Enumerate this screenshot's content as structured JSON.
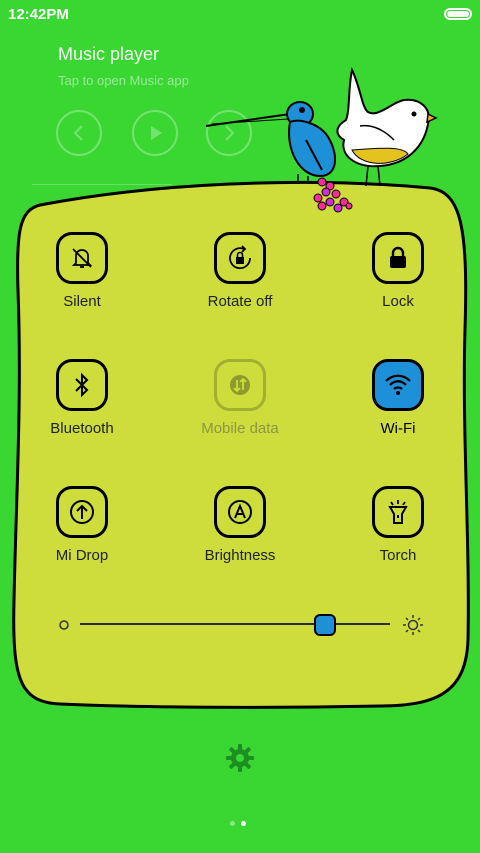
{
  "status_bar": {
    "time": "12:42PM",
    "battery_icon": "battery-full-icon"
  },
  "music_player": {
    "title": "Music player",
    "subtitle": "Tap to open Music app",
    "controls": [
      "previous-icon",
      "play-icon",
      "next-icon"
    ]
  },
  "toggles": [
    {
      "label": "Silent",
      "icon": "bell-off-icon",
      "state": "off"
    },
    {
      "label": "Rotate off",
      "icon": "rotate-lock-icon",
      "state": "off"
    },
    {
      "label": "Lock",
      "icon": "padlock-icon",
      "state": "off"
    },
    {
      "label": "Bluetooth",
      "icon": "bluetooth-icon",
      "state": "off"
    },
    {
      "label": "Mobile data",
      "icon": "mobile-data-icon",
      "state": "disabled"
    },
    {
      "label": "Wi-Fi",
      "icon": "wifi-icon",
      "state": "on"
    },
    {
      "label": "Mi Drop",
      "icon": "upload-arrow-icon",
      "state": "off"
    },
    {
      "label": "Brightness",
      "icon": "auto-brightness-icon",
      "state": "off"
    },
    {
      "label": "Torch",
      "icon": "flashlight-icon",
      "state": "off"
    }
  ],
  "brightness_slider": {
    "level": 0.79,
    "min_icon": "dim-sun-icon",
    "max_icon": "bright-sun-icon"
  },
  "settings_icon": "gear-icon",
  "page_indicator": {
    "pages": 2,
    "current": 2
  },
  "colors": {
    "background": "#3ad632",
    "panel": "#cedd3b",
    "accent": "#1e90d8"
  }
}
